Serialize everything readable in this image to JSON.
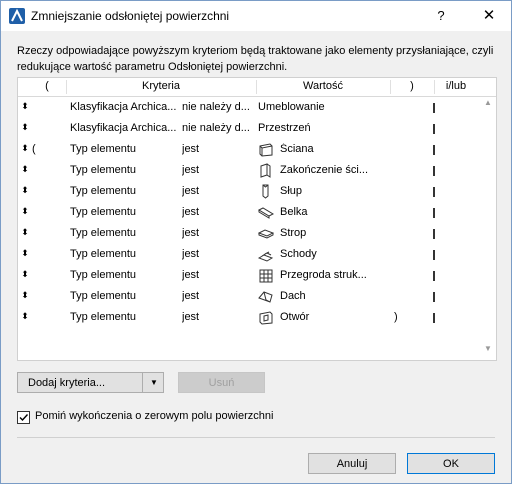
{
  "window": {
    "title": "Zmniejszanie odsłoniętej powierzchni",
    "help": "?",
    "close": "✕"
  },
  "description": "Rzeczy odpowiadające powyższym kryteriom będą traktowane jako elementy przysłaniające, czyli redukujące wartość parametru Odsłoniętej powierzchni.",
  "table": {
    "headers": {
      "open": "(",
      "criteria": "Kryteria",
      "value": "Wartość",
      "close": ")",
      "andor": "i/lub"
    },
    "rows": [
      {
        "drag": "⬍",
        "open": "",
        "criteria": "Klasyfikacja Archica...",
        "operator": "nie należy d...",
        "icon": "",
        "value": "Umeblowanie",
        "close": ""
      },
      {
        "drag": "⬍",
        "open": "",
        "criteria": "Klasyfikacja Archica...",
        "operator": "nie należy d...",
        "icon": "",
        "value": "Przestrzeń",
        "close": ""
      },
      {
        "drag": "⬍",
        "open": "(",
        "criteria": "Typ elementu",
        "operator": "jest",
        "icon": "wall-icon",
        "value": "Ściana",
        "close": ""
      },
      {
        "drag": "⬍",
        "open": "",
        "criteria": "Typ elementu",
        "operator": "jest",
        "icon": "wall-end-icon",
        "value": "Zakończenie ści...",
        "close": ""
      },
      {
        "drag": "⬍",
        "open": "",
        "criteria": "Typ elementu",
        "operator": "jest",
        "icon": "column-icon",
        "value": "Słup",
        "close": ""
      },
      {
        "drag": "⬍",
        "open": "",
        "criteria": "Typ elementu",
        "operator": "jest",
        "icon": "beam-icon",
        "value": "Belka",
        "close": ""
      },
      {
        "drag": "⬍",
        "open": "",
        "criteria": "Typ elementu",
        "operator": "jest",
        "icon": "slab-icon",
        "value": "Strop",
        "close": ""
      },
      {
        "drag": "⬍",
        "open": "",
        "criteria": "Typ elementu",
        "operator": "jest",
        "icon": "stair-icon",
        "value": "Schody",
        "close": ""
      },
      {
        "drag": "⬍",
        "open": "",
        "criteria": "Typ elementu",
        "operator": "jest",
        "icon": "curtain-wall-icon",
        "value": "Przegroda struk...",
        "close": ""
      },
      {
        "drag": "⬍",
        "open": "",
        "criteria": "Typ elementu",
        "operator": "jest",
        "icon": "roof-icon",
        "value": "Dach",
        "close": ""
      },
      {
        "drag": "⬍",
        "open": "",
        "criteria": "Typ elementu",
        "operator": "jest",
        "icon": "opening-icon",
        "value": "Otwór",
        "close": ")"
      }
    ]
  },
  "buttons": {
    "add_criteria": "Dodaj kryteria...",
    "remove": "Usuń",
    "cancel": "Anuluj",
    "ok": "OK"
  },
  "checkbox": {
    "label": "Pomiń wykończenia o zerowym polu powierzchni",
    "checked": true
  }
}
